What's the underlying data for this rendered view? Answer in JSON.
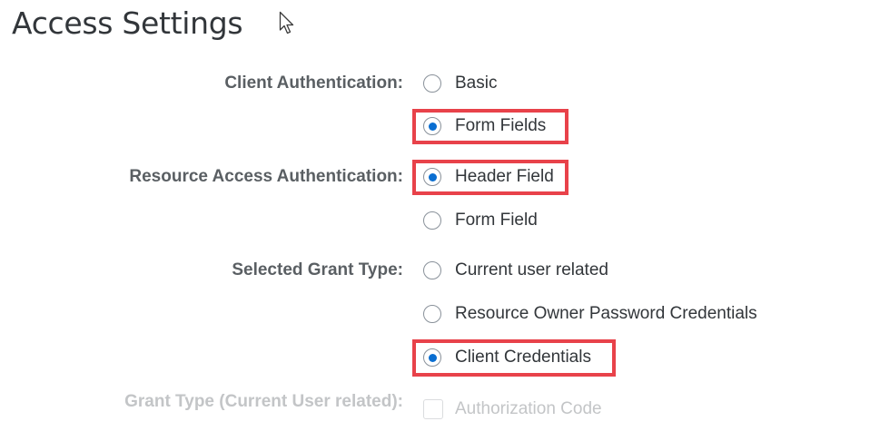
{
  "page": {
    "title": "Access Settings"
  },
  "client_auth": {
    "label": "Client Authentication:",
    "options": [
      {
        "label": "Basic",
        "checked": false
      },
      {
        "label": "Form Fields",
        "checked": true,
        "highlighted": true
      }
    ]
  },
  "resource_auth": {
    "label": "Resource Access Authentication:",
    "options": [
      {
        "label": "Header Field",
        "checked": true,
        "highlighted": true
      },
      {
        "label": "Form Field",
        "checked": false
      }
    ]
  },
  "grant_type": {
    "label": "Selected Grant Type:",
    "options": [
      {
        "label": "Current user related",
        "checked": false
      },
      {
        "label": "Resource Owner Password Credentials",
        "checked": false
      },
      {
        "label": "Client Credentials",
        "checked": true,
        "highlighted": true
      }
    ]
  },
  "grant_type_current_user": {
    "label": "Grant Type (Current User related):",
    "disabled": true,
    "options": [
      {
        "label": "Authorization Code",
        "checked": false,
        "disabled": true
      }
    ]
  },
  "colors": {
    "highlight": "#e8424a",
    "radio_selected": "#0a6ed1",
    "label": "#5a5f63",
    "disabled": "#c3c5c7"
  }
}
